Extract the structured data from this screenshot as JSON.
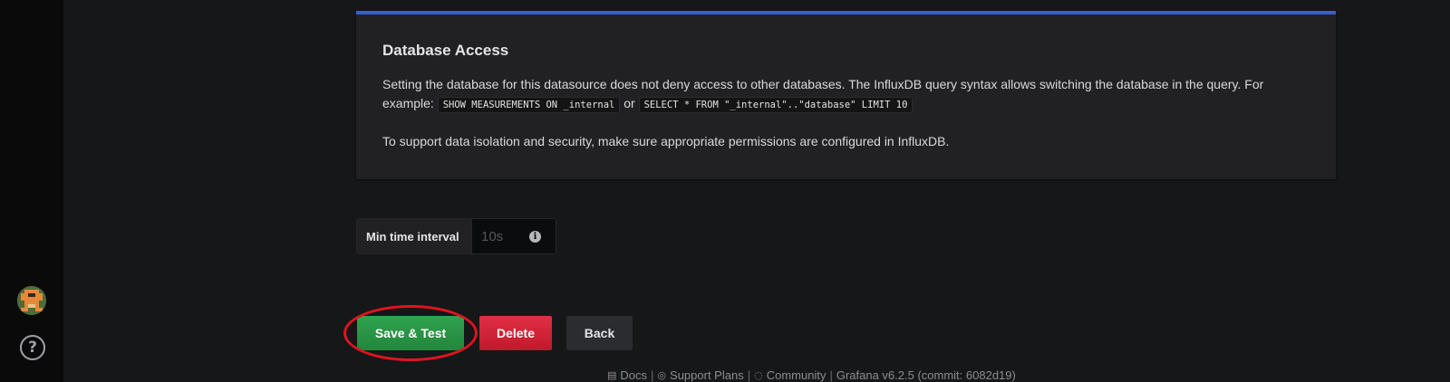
{
  "alert": {
    "title": "Database Access",
    "line1": "Setting the database for this datasource does not deny access to other databases. The InfluxDB query syntax allows switching the database in the query. For example:",
    "code1": "SHOW MEASUREMENTS ON _internal",
    "or": "or",
    "code2": "SELECT * FROM \"_internal\"..\"database\" LIMIT 10",
    "line2": "To support data isolation and security, make sure appropriate permissions are configured in InfluxDB."
  },
  "min_interval": {
    "label": "Min time interval",
    "placeholder": "10s",
    "info_icon": "info-icon"
  },
  "buttons": {
    "save": "Save & Test",
    "delete": "Delete",
    "back": "Back"
  },
  "footer": {
    "docs": "Docs",
    "support": "Support Plans",
    "community": "Community",
    "version": "Grafana v6.2.5 (commit: 6082d19)"
  },
  "colors": {
    "save": "#2fa34d",
    "delete": "#e02f44",
    "accent": "#2d62d3",
    "highlight": "#e0141f"
  }
}
